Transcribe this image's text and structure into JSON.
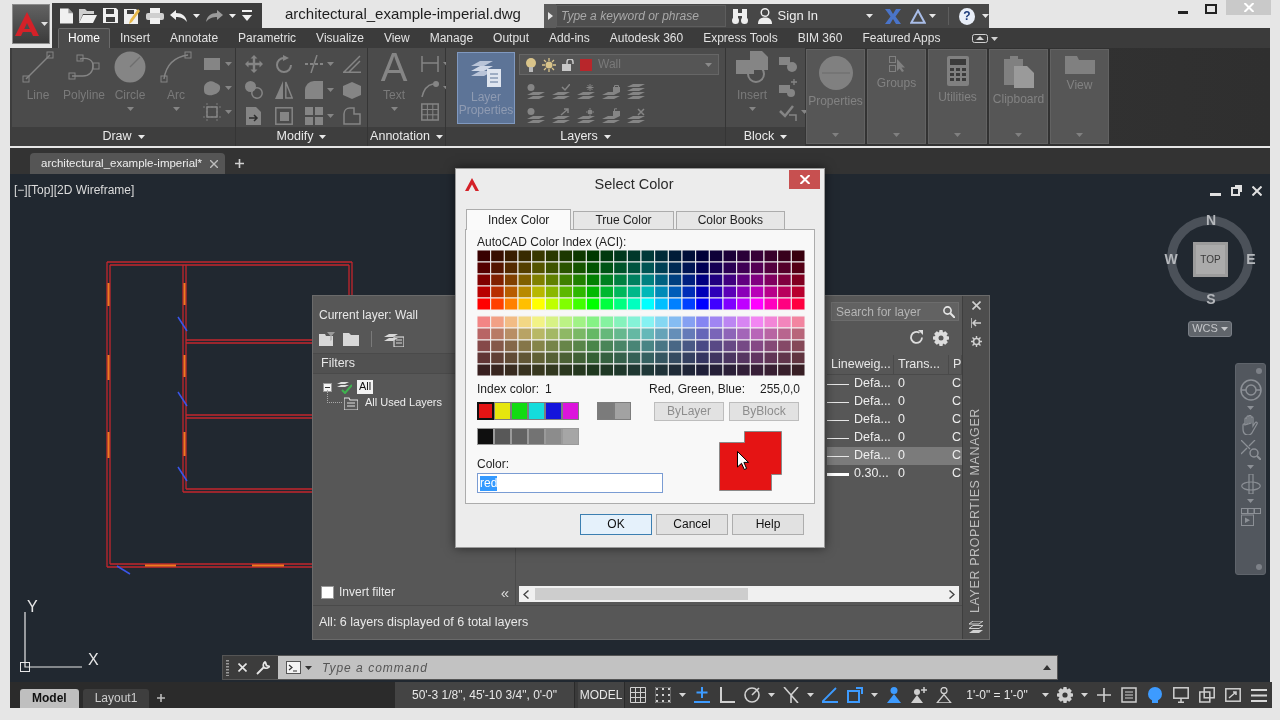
{
  "window": {
    "title": "architectural_example-imperial.dwg"
  },
  "search": {
    "placeholder": "Type a keyword or phrase"
  },
  "account": {
    "label": "Sign In"
  },
  "help_button": "?",
  "ribbon_tabs": [
    {
      "label": "Home",
      "selected": true
    },
    {
      "label": "Insert",
      "selected": false
    },
    {
      "label": "Annotate",
      "selected": false
    },
    {
      "label": "Parametric",
      "selected": false
    },
    {
      "label": "Visualize",
      "selected": false
    },
    {
      "label": "View",
      "selected": false
    },
    {
      "label": "Manage",
      "selected": false
    },
    {
      "label": "Output",
      "selected": false
    },
    {
      "label": "Add-ins",
      "selected": false
    },
    {
      "label": "Autodesk 360",
      "selected": false
    },
    {
      "label": "Express Tools",
      "selected": false
    },
    {
      "label": "BIM 360",
      "selected": false
    },
    {
      "label": "Featured Apps",
      "selected": false
    }
  ],
  "ribbon": {
    "disabled": true,
    "panels": [
      {
        "kind": "draw",
        "title": "Draw",
        "tools": [
          {
            "label": "Line",
            "dropdown": false
          },
          {
            "label": "Polyline",
            "dropdown": false
          },
          {
            "label": "Circle",
            "dropdown": true
          },
          {
            "label": "Arc",
            "dropdown": true
          }
        ]
      },
      {
        "kind": "modify",
        "title": "Modify"
      },
      {
        "kind": "annotation",
        "title": "Annotation",
        "tools": [
          {
            "label": "Text",
            "glyph": "A",
            "dropdown": true
          }
        ]
      },
      {
        "kind": "layers",
        "title": "Layers",
        "tools": [
          {
            "label": "Layer Properties",
            "active": true
          }
        ],
        "current_layer": "Wall"
      },
      {
        "kind": "block",
        "title": "Block",
        "tools": [
          {
            "label": "Insert",
            "dropdown": true
          }
        ]
      },
      {
        "kind": "properties",
        "label": "Properties"
      },
      {
        "kind": "groups",
        "label": "Groups"
      },
      {
        "kind": "utilities",
        "label": "Utilities"
      },
      {
        "kind": "clipboard",
        "label": "Clipboard"
      },
      {
        "kind": "view",
        "label": "View"
      }
    ]
  },
  "file_tabs": [
    {
      "label": "architectural_example-imperial*",
      "selected": true
    }
  ],
  "viewport": {
    "label": "[−][Top][2D Wireframe]"
  },
  "viewcube": {
    "north": "N",
    "west": "W",
    "top_face": "TOP",
    "east": "E",
    "south": "S",
    "ucs": "WCS"
  },
  "layer_manager": {
    "title": "LAYER PROPERTIES MANAGER",
    "current_layer": "Current layer: Wall",
    "search": {
      "placeholder": "Search for layer"
    },
    "filters_heading": "Filters",
    "filters": [
      {
        "label": "All",
        "selected": true,
        "expanded": true,
        "children": [
          {
            "label": "All Used Layers",
            "selected": false
          }
        ]
      }
    ],
    "columns": [
      "Lineweig...",
      "Trans...",
      "P"
    ],
    "rows": [
      {
        "kind": "thin",
        "lineweight": "Defa...",
        "transparency": "0",
        "plot_style": "C",
        "selected": false
      },
      {
        "kind": "thin",
        "lineweight": "Defa...",
        "transparency": "0",
        "plot_style": "C",
        "selected": false
      },
      {
        "kind": "thin",
        "lineweight": "Defa...",
        "transparency": "0",
        "plot_style": "C",
        "selected": false
      },
      {
        "kind": "thin",
        "lineweight": "Defa...",
        "transparency": "0",
        "plot_style": "C",
        "selected": false
      },
      {
        "kind": "thin",
        "lineweight": "Defa...",
        "transparency": "0",
        "plot_style": "C",
        "selected": true
      },
      {
        "kind": "thick",
        "lineweight": "0.30...",
        "transparency": "0",
        "plot_style": "C",
        "selected": false
      }
    ],
    "invert_filter": {
      "label": "Invert filter",
      "checked": false
    },
    "collapse": "«",
    "status": "All: 6 layers displayed of 6 total layers"
  },
  "select_color": {
    "title": "Select Color",
    "tabs": [
      {
        "label": "Index Color",
        "selected": true
      },
      {
        "label": "True Color",
        "selected": false
      },
      {
        "label": "Color Books",
        "selected": false
      }
    ],
    "palette_label": "AutoCAD Color Index (ACI):",
    "index_label": "Index color:",
    "index_value": "1",
    "rgb_label": "Red, Green, Blue:",
    "rgb_value": "255,0,0",
    "standard_colors": [
      {
        "color": "#e51414",
        "selected": true
      },
      {
        "color": "#e6e60e",
        "selected": false
      },
      {
        "color": "#12dc12",
        "selected": false
      },
      {
        "color": "#14dcdc",
        "selected": false
      },
      {
        "color": "#1414dc",
        "selected": false
      },
      {
        "color": "#dc14dc",
        "selected": false
      }
    ],
    "gray_colors": [
      {
        "color": "#7b7b7b",
        "selected": false
      },
      {
        "color": "#a2a2a2",
        "selected": false
      }
    ],
    "shade_colors": [
      {
        "color": "#0f0f0f",
        "selected": false
      },
      {
        "color": "#585858",
        "selected": false
      },
      {
        "color": "#636363",
        "selected": false
      },
      {
        "color": "#737373",
        "selected": false
      },
      {
        "color": "#8c8c8c",
        "selected": false
      },
      {
        "color": "#a6a6a6",
        "selected": false
      }
    ],
    "by_buttons": [
      {
        "label": "ByLayer",
        "disabled": true
      },
      {
        "label": "ByBlock",
        "disabled": true
      }
    ],
    "color_label": "Color:",
    "color_value": "red",
    "text_selected": true,
    "buttons": [
      {
        "label": "OK",
        "default": true
      },
      {
        "label": "Cancel",
        "default": false
      },
      {
        "label": "Help",
        "default": false
      }
    ]
  },
  "ucs_icon": {
    "y_label": "Y",
    "x_label": "X"
  },
  "command_line": {
    "placeholder": "Type a command"
  },
  "status_bar": {
    "layout_tabs": [
      {
        "label": "Model",
        "selected": true
      },
      {
        "label": "Layout1",
        "selected": false
      }
    ],
    "coordinates": "50'-3 1/8\", 45'-10 3/4\", 0'-0\"",
    "space": "MODEL",
    "toggles": [
      {
        "kind": "grid",
        "on": false
      },
      {
        "kind": "snap",
        "on": false,
        "dropdown": true
      },
      {
        "kind": "infer",
        "on": true
      },
      {
        "kind": "ortho",
        "on": false
      },
      {
        "kind": "polar",
        "on": false,
        "dropdown": true
      },
      {
        "kind": "isodraft",
        "on": false,
        "dropdown": true
      },
      {
        "kind": "tracking",
        "on": true
      },
      {
        "kind": "osnap",
        "on": true,
        "dropdown": true
      },
      {
        "kind": "annotation_visibility",
        "on": true
      },
      {
        "kind": "auto_scale",
        "on": false
      },
      {
        "kind": "annotation_scale",
        "on": false
      }
    ],
    "annotation_scale": "1'-0\" = 1'-0\"",
    "tail_toggles": [
      {
        "kind": "quick_properties",
        "on": false
      },
      {
        "kind": "isolate",
        "on": true
      },
      {
        "kind": "hardware",
        "on": false
      },
      {
        "kind": "graphics",
        "on": false
      },
      {
        "kind": "clean_screen",
        "on": false
      }
    ]
  }
}
